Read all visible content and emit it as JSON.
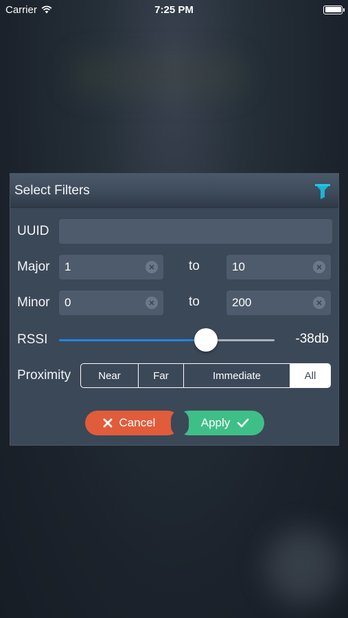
{
  "status_bar": {
    "carrier": "Carrier",
    "time": "7:25 PM",
    "icons": [
      "wifi-icon",
      "battery-icon"
    ]
  },
  "dialog": {
    "title": "Select Filters",
    "title_icon": "filter-icon",
    "accent_color": "#19b5d6",
    "uuid": {
      "label": "UUID",
      "value": ""
    },
    "major": {
      "label": "Major",
      "from": "1",
      "to_label": "to",
      "to": "10"
    },
    "minor": {
      "label": "Minor",
      "from": "0",
      "to_label": "to",
      "to": "200"
    },
    "rssi": {
      "label": "RSSI",
      "value_text": "-38db",
      "level": 0.68
    },
    "proximity": {
      "label": "Proximity",
      "options": [
        "Near",
        "Far",
        "Immediate",
        "All"
      ],
      "selected": "All"
    },
    "buttons": {
      "cancel_label": "Cancel",
      "apply_label": "Apply",
      "cancel_color": "#e15c3a",
      "apply_color": "#3fbf88"
    }
  }
}
